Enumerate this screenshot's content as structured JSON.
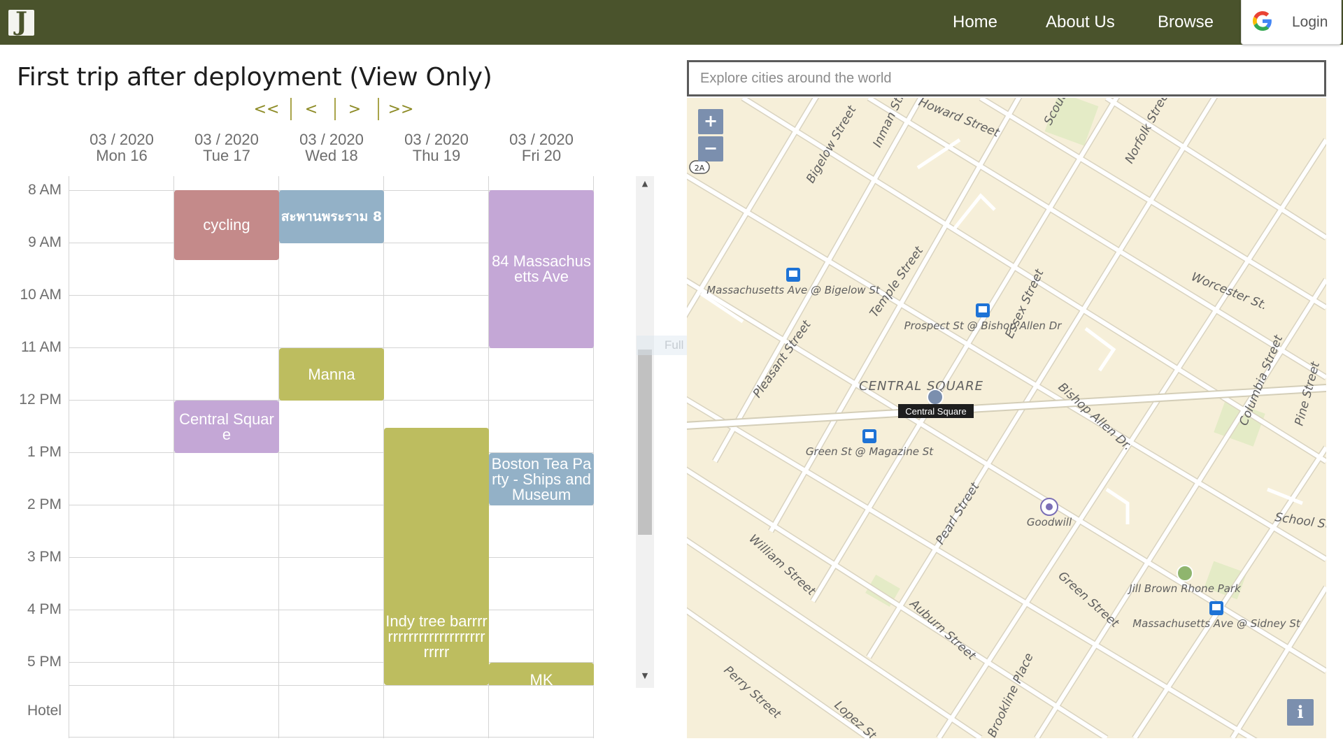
{
  "nav": {
    "logo_text": "J",
    "home": "Home",
    "about": "About Us",
    "browse": "Browse",
    "login": "Login"
  },
  "trip": {
    "title": "First trip after deployment (View Only)"
  },
  "pager": {
    "first": "<<",
    "prev": "<",
    "next": ">",
    "last": ">>"
  },
  "days": [
    {
      "month": "03 / 2020",
      "day": "Mon 16"
    },
    {
      "month": "03 / 2020",
      "day": "Tue 17"
    },
    {
      "month": "03 / 2020",
      "day": "Wed 18"
    },
    {
      "month": "03 / 2020",
      "day": "Thu 19"
    },
    {
      "month": "03 / 2020",
      "day": "Fri 20"
    }
  ],
  "hours": [
    "8 AM",
    "9 AM",
    "10 AM",
    "11 AM",
    "12 PM",
    "1 PM",
    "2 PM",
    "3 PM",
    "4 PM",
    "5 PM"
  ],
  "hotel_label": "Hotel",
  "events": [
    {
      "title": "cycling",
      "color": "#c48a8a"
    },
    {
      "title": "สะพานพระราม 8",
      "color": "#93b1c7"
    },
    {
      "title": "84 Massachusetts Ave",
      "color": "#c4a7d6"
    },
    {
      "title": "Manna",
      "color": "#bdbd5f"
    },
    {
      "title": "Central Square",
      "color": "#c4a7d6"
    },
    {
      "title": "Indy tree barrrrrrrrrrrrrrrrrrrrrrrrrrrr",
      "color": "#bdbd5f"
    },
    {
      "title": "Boston Tea Party - Ships and Museum",
      "color": "#93b1c7"
    },
    {
      "title": "MK",
      "color": "#bdbd5f"
    }
  ],
  "ghost_text": "Full screen Snip",
  "map": {
    "search_placeholder": "Explore cities around the world",
    "zoom_in": "+",
    "zoom_out": "−",
    "info": "i",
    "streets": [
      "Bigelow Street",
      "Inman Street",
      "Howard Street",
      "Scouting Way",
      "Norfolk Street",
      "Worcester St.",
      "Temple Street",
      "Essex Street",
      "Pleasant Street",
      "Bishop Allen Dr.",
      "Columbia Street",
      "Pine Street",
      "Pearl Street",
      "William Street",
      "Auburn Street",
      "Green Street",
      "Perry Street",
      "Lopez St",
      "Brookline Place",
      "School St"
    ],
    "stops": [
      "Massachusetts Ave @ Bigelow St",
      "Prospect St @ Bishop Allen Dr",
      "Green St @ Magazine St",
      "Massachusetts Ave @ Sidney St"
    ],
    "places": [
      "CENTRAL SQUARE",
      "Central Square",
      "Goodwill",
      "Jill Brown Rhone Park"
    ],
    "route_badge": "2A",
    "colors": {
      "land": "#f6efd9",
      "road": "#ffffff",
      "road_edge": "#d9d3c0",
      "park": "#e4ebc6",
      "transit": "#1e73d6"
    }
  }
}
